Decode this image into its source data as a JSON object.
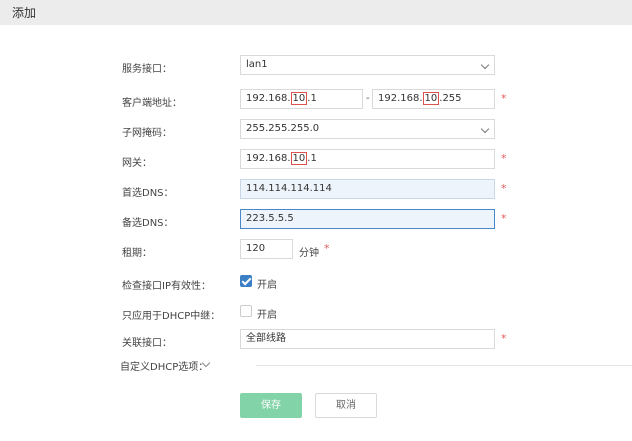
{
  "dialog": {
    "title": "添加"
  },
  "form": {
    "service_interface": {
      "label": "服务接口：",
      "value": "lan1"
    },
    "client_address": {
      "label": "客户端地址：",
      "start": {
        "prefix": "192.168.",
        "octet": "10",
        "suffix": ".1"
      },
      "separator": "-",
      "end": {
        "prefix": "192.168.",
        "octet": "10",
        "suffix": ".255"
      },
      "required_mark": "*"
    },
    "subnet_mask": {
      "label": "子网掩码：",
      "value": "255.255.255.0"
    },
    "gateway": {
      "label": "网关：",
      "prefix": "192.168.",
      "octet": "10",
      "suffix": ".1",
      "required_mark": "*"
    },
    "primary_dns": {
      "label": "首选DNS：",
      "value": "114.114.114.114",
      "required_mark": "*"
    },
    "secondary_dns": {
      "label": "备选DNS：",
      "value": "223.5.5.5",
      "required_mark": "*"
    },
    "lease": {
      "label": "租期：",
      "value": "120",
      "unit": "分钟",
      "required_mark": "*"
    },
    "check_ip_validity": {
      "label": "检查接口IP有效性：",
      "checked": true,
      "option": "开启"
    },
    "dhcp_relay_only": {
      "label": "只应用于DHCP中继：",
      "checked": false,
      "option": "开启"
    },
    "linked_interface": {
      "label": "关联接口：",
      "value": "全部线路",
      "required_mark": "*"
    }
  },
  "advanced": {
    "label": "自定义DHCP选项："
  },
  "buttons": {
    "save": "保存",
    "cancel": "取消"
  },
  "colors": {
    "save_button": "#82d3a7",
    "checkbox_on": "#3b7fc4",
    "required": "#e25c5c",
    "focus_border": "#4a87c9"
  }
}
